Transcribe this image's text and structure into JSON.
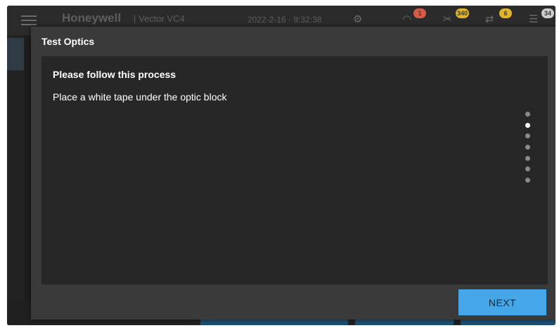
{
  "background_app": {
    "brand": "Honeywell",
    "product": "| Vector VC4",
    "datetime": "2022-2-16 · 9:32:38",
    "header_icons": [
      {
        "name": "network-icon",
        "glyph": "⚙"
      },
      {
        "name": "bell-icon",
        "glyph": "🔔",
        "badge": "1",
        "badge_color": "#d65a4a"
      },
      {
        "name": "tools-icon",
        "glyph": "✂",
        "badge": "340",
        "badge_color": "#e0b52a"
      },
      {
        "name": "plug-icon",
        "glyph": "⇄",
        "badge": "6",
        "badge_color": "#e0b52a"
      },
      {
        "name": "list-icon",
        "glyph": "☰",
        "badge": "34",
        "badge_color": "#cccccc"
      }
    ]
  },
  "modal": {
    "title": "Test Optics",
    "heading": "Please follow this process",
    "instruction": "Place a white tape under the optic block",
    "steps_total": 7,
    "active_step": 2,
    "next_label": "NEXT",
    "next_color": "#45a7e8"
  }
}
